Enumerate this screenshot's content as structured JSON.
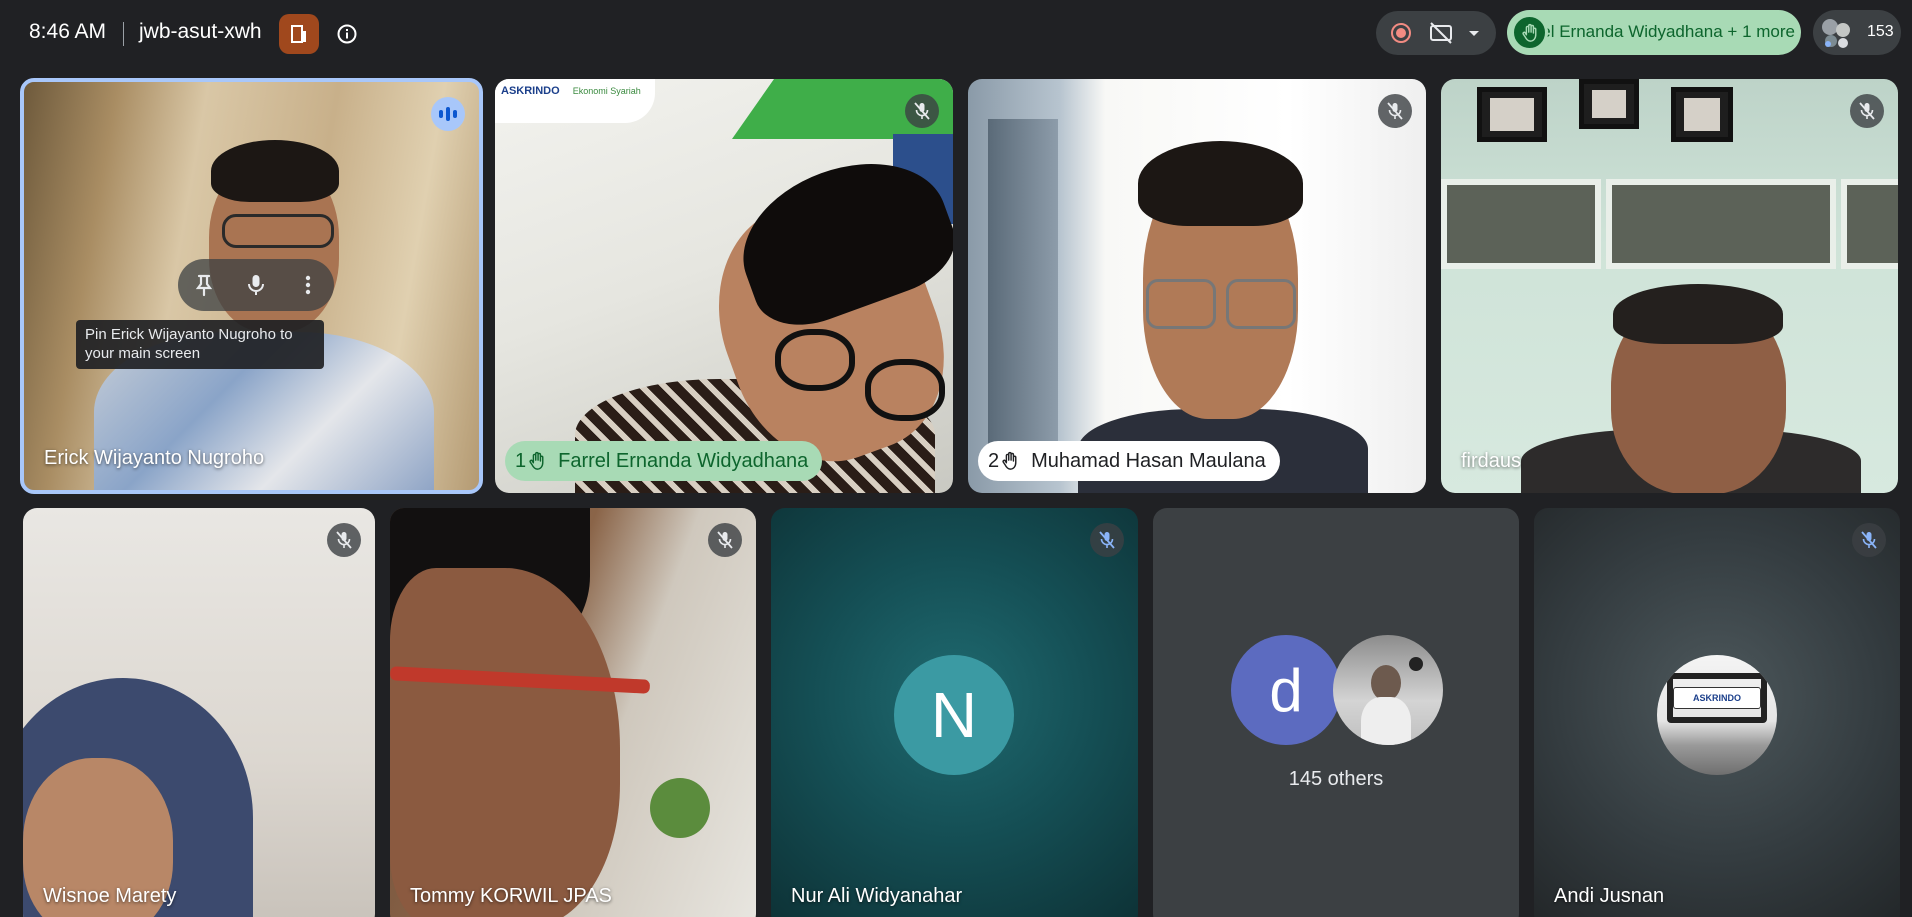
{
  "header": {
    "time": "8:46 AM",
    "meeting_code": "jwb-asut-xwh",
    "raised_hands": "rel Ernanda Widyadhana + 1 more",
    "participant_count": "153"
  },
  "tiles": [
    {
      "name": "Erick Wijayanto Nugroho",
      "speaking": true,
      "tooltip": "Pin Erick Wijayanto Nugroho to your main screen"
    },
    {
      "name": "Farrel Ernanda Widyadhana",
      "hand_order": "1",
      "muted": true,
      "logo_text": "ASKRINDO",
      "logo_sub": "Ekonomi Syariah"
    },
    {
      "name": "Muhamad Hasan Maulana",
      "hand_order": "2",
      "muted": true
    },
    {
      "name": "firdaus",
      "muted": true
    },
    {
      "name": "Wisnoe Marety",
      "muted": true
    },
    {
      "name": "Tommy KORWIL JPAS",
      "muted": true
    },
    {
      "name": "Nur Ali Widyanahar",
      "muted": true,
      "initial": "N"
    },
    {
      "others_initial": "d",
      "others_label": "145 others"
    },
    {
      "name": "Andi Jusnan",
      "muted": true,
      "logo_text": "ASKRINDO"
    }
  ],
  "colors": {
    "accent_speaking": "#a8c7fa",
    "hand_raise_bg": "#a8dab5",
    "hand_raise_fg": "#0d652d",
    "background": "#202124"
  }
}
